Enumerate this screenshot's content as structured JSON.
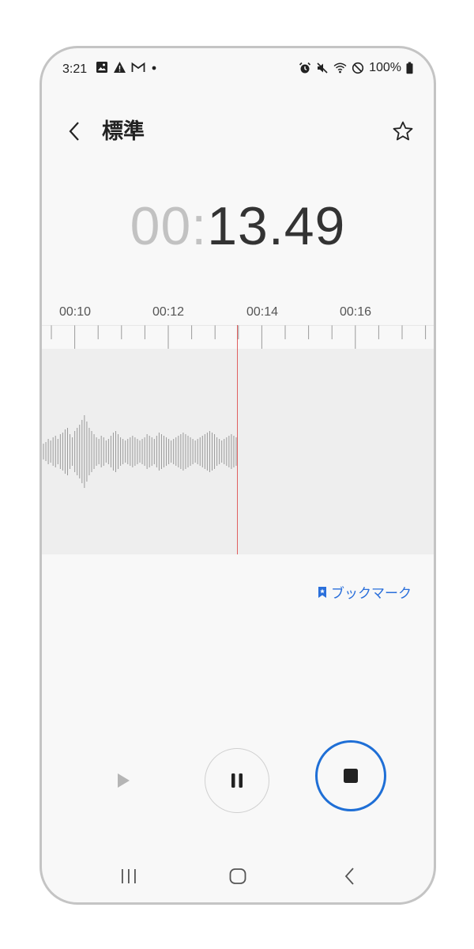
{
  "status_bar": {
    "time": "3:21",
    "battery": "100%",
    "left_icons": [
      "image-icon",
      "warning-icon",
      "gmail-icon",
      "dot-icon"
    ],
    "right_icons": [
      "alarm-icon",
      "mute-icon",
      "wifi-icon",
      "do-not-disturb-icon",
      "battery-icon"
    ]
  },
  "header": {
    "title": "標準"
  },
  "timer": {
    "minutes": "00",
    "separator": ":",
    "seconds": "13.49"
  },
  "timeline": {
    "labels": [
      "00:10",
      "00:12",
      "00:14",
      "00:16"
    ]
  },
  "bookmark": {
    "label": "ブックマーク"
  },
  "colors": {
    "accent": "#1f6fd6",
    "playhead": "#e06060",
    "wave": "#9a9a9a"
  }
}
